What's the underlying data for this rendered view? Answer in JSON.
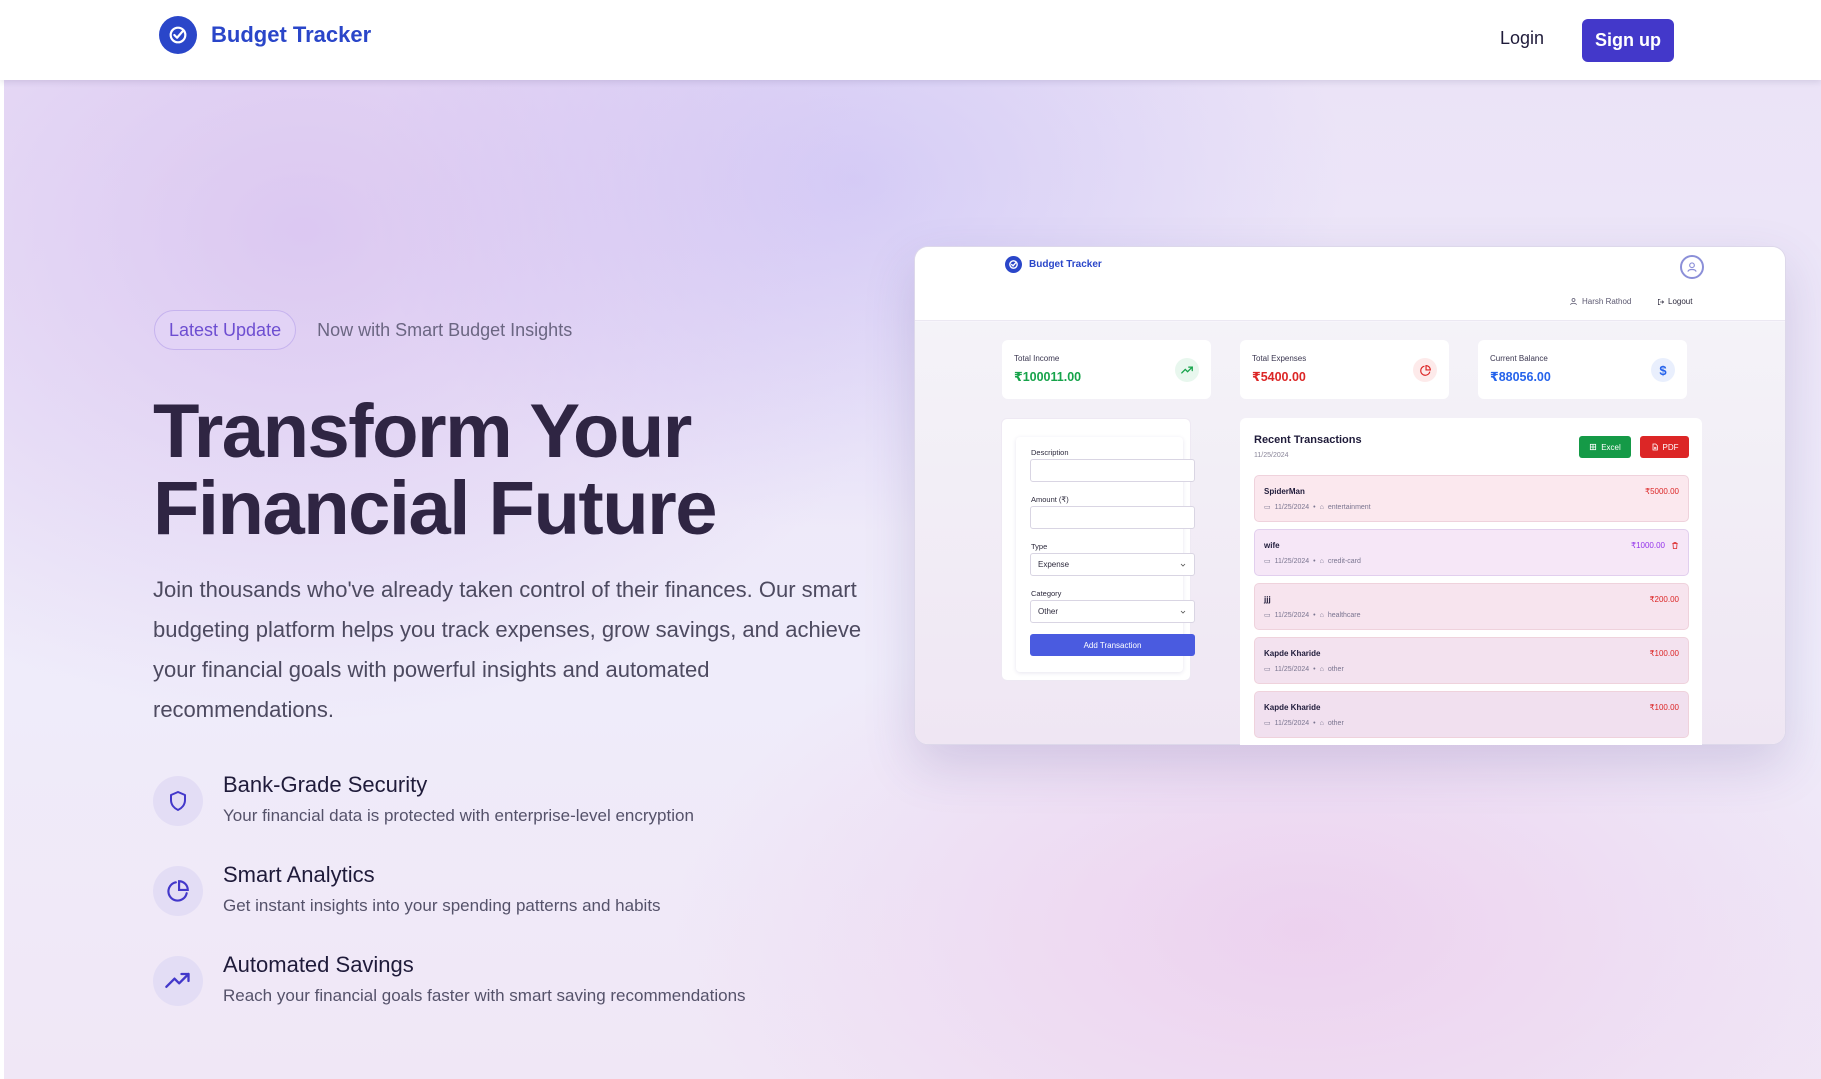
{
  "nav": {
    "brand": "Budget Tracker",
    "login": "Login",
    "signup": "Sign up"
  },
  "hero": {
    "badge": "Latest Update",
    "badge_text": "Now with Smart Budget Insights",
    "headline": "Transform Your\nFinancial Future",
    "subtext": "Join thousands who've already taken control of their finances. Our smart budgeting platform helps you track expenses, grow savings, and achieve your financial goals with powerful insights and automated recommendations.",
    "features": [
      {
        "icon": "shield-icon",
        "title": "Bank-Grade Security",
        "desc": "Your financial data is protected with enterprise-level encryption"
      },
      {
        "icon": "pie-chart-icon",
        "title": "Smart Analytics",
        "desc": "Get instant insights into your spending patterns and habits"
      },
      {
        "icon": "trending-up-icon",
        "title": "Automated Savings",
        "desc": "Reach your financial goals faster with smart saving recommendations"
      }
    ]
  },
  "preview": {
    "brand": "Budget Tracker",
    "user": "Harsh Rathod",
    "logout": "Logout",
    "stats": [
      {
        "label": "Total Income",
        "value": "₹100011.00",
        "color": "#16a34a",
        "icon": "trending-up-icon"
      },
      {
        "label": "Total Expenses",
        "value": "₹5400.00",
        "color": "#dc2626",
        "icon": "pie-chart-icon"
      },
      {
        "label": "Current Balance",
        "value": "₹88056.00",
        "color": "#2563eb",
        "icon": "dollar-icon"
      }
    ],
    "form": {
      "description_label": "Description",
      "amount_label": "Amount (₹)",
      "type_label": "Type",
      "type_value": "Expense",
      "category_label": "Category",
      "category_value": "Other",
      "submit": "Add Transaction"
    },
    "transactions": {
      "title": "Recent Transactions",
      "date": "11/25/2024",
      "excel": "Excel",
      "pdf": "PDF",
      "rows": [
        {
          "name": "SpiderMan",
          "date": "11/25/2024",
          "category": "entertainment",
          "amount": "₹5000.00",
          "amount_color": "#dc2626"
        },
        {
          "name": "wife",
          "date": "11/25/2024",
          "category": "credit-card",
          "amount": "₹1000.00",
          "amount_color": "#9333ea"
        },
        {
          "name": "jjj",
          "date": "11/25/2024",
          "category": "healthcare",
          "amount": "₹200.00",
          "amount_color": "#dc2626"
        },
        {
          "name": "Kapde Kharide",
          "date": "11/25/2024",
          "category": "other",
          "amount": "₹100.00",
          "amount_color": "#dc2626"
        },
        {
          "name": "Kapde Kharide",
          "date": "11/25/2024",
          "category": "other",
          "amount": "₹100.00",
          "amount_color": "#dc2626"
        }
      ]
    }
  }
}
